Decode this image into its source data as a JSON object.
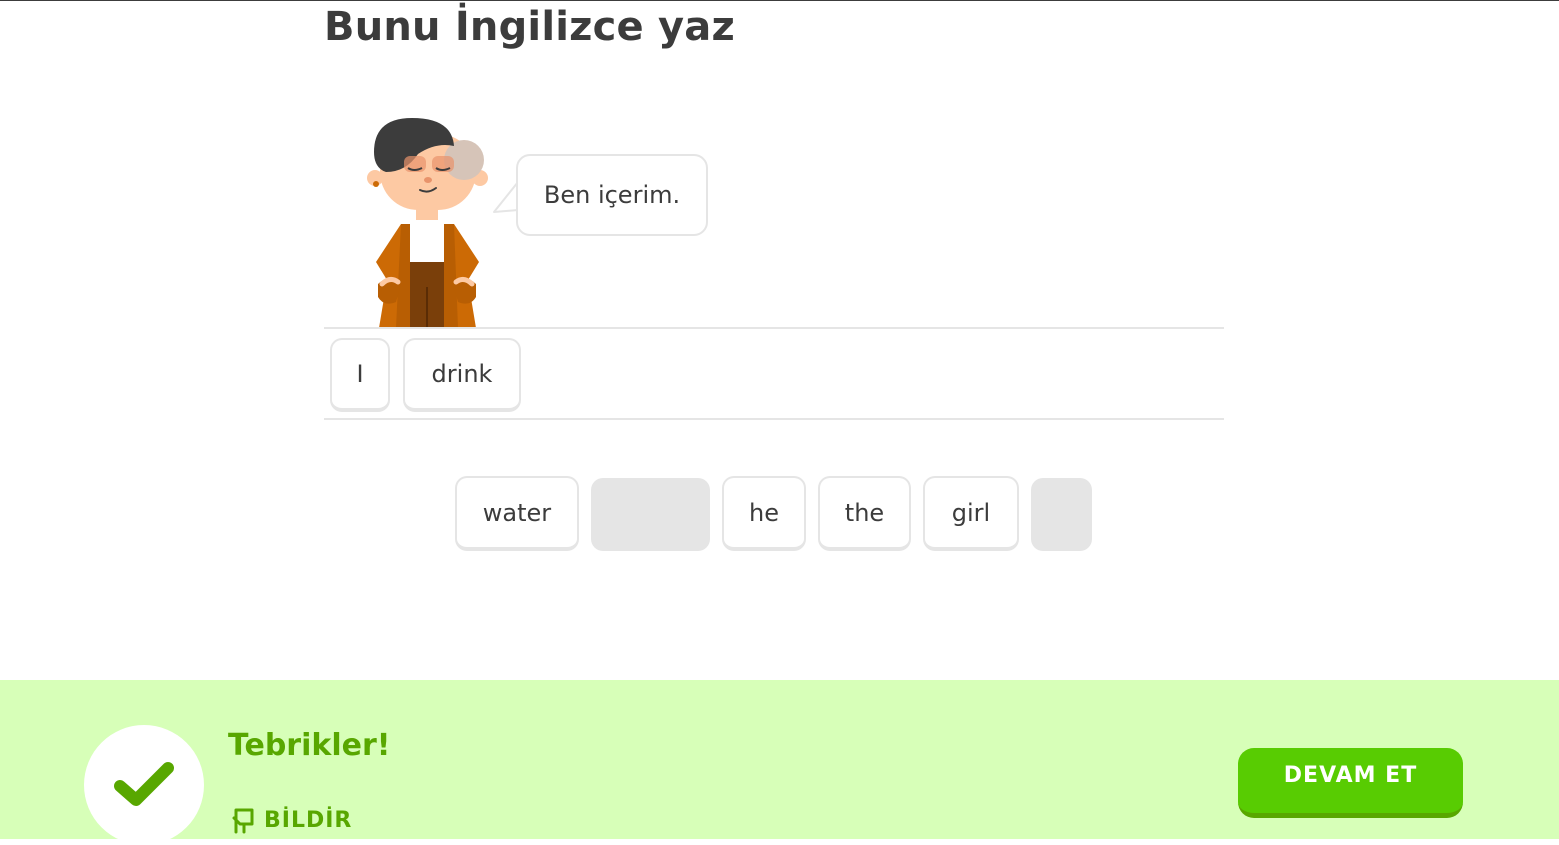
{
  "header": {
    "title": "Bunu İngilizce yaz"
  },
  "prompt": {
    "sentence": "Ben içerim."
  },
  "answer": {
    "tiles": [
      {
        "label": "I"
      },
      {
        "label": "drink"
      }
    ]
  },
  "word_bank": {
    "tiles": [
      {
        "label": "water",
        "used": false
      },
      {
        "label": "",
        "used": true
      },
      {
        "label": "he",
        "used": false
      },
      {
        "label": "the",
        "used": false
      },
      {
        "label": "girl",
        "used": false
      },
      {
        "label": "",
        "used": true
      }
    ]
  },
  "feedback": {
    "message": "Tebrikler!",
    "report_label": "BİLDİR",
    "continue_label": "DEVAM ET",
    "icon": "checkmark-icon"
  },
  "colors": {
    "success_bg": "#d7ffb8",
    "success_text": "#58a700",
    "button": "#58cc02",
    "tile_border": "#e5e5e5",
    "text": "#3c3c3c"
  }
}
